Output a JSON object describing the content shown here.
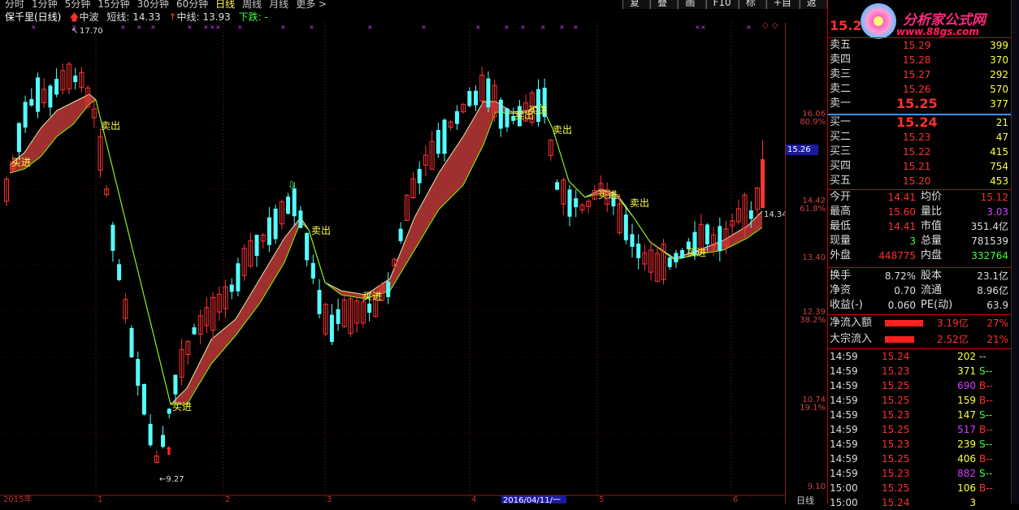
{
  "topbar": {
    "periods": [
      "分时",
      "1分钟",
      "5分钟",
      "15分钟",
      "30分钟",
      "60分钟",
      "日线",
      "周线",
      "月线",
      "更多 >"
    ],
    "active_period": "日线",
    "buttons": [
      "复权",
      "叠加",
      "画线",
      "F10",
      "标记",
      "+自选",
      "返回"
    ]
  },
  "info": {
    "stock": "保千里(日线)",
    "wave": "中波",
    "short_label": "短线:",
    "short_value": "14.33",
    "mid_label": "中线:",
    "mid_value": "13.93",
    "down_label": "下跌:",
    "down_value": "-"
  },
  "chart": {
    "high_label": "17.70",
    "low_label": "9.27",
    "last_label": "14.34",
    "current_price": "15.26",
    "y_axis": [
      {
        "price": "16.06",
        "pct": "80.9%"
      },
      {
        "price": "14.42",
        "pct": "61.8%"
      },
      {
        "price": "13.40",
        "pct": ""
      },
      {
        "price": "12.39",
        "pct": "38.2%"
      },
      {
        "price": "10.74",
        "pct": "19.1%"
      },
      {
        "price": "9.10",
        "pct": ""
      }
    ],
    "x_labels": [
      "2015年",
      "1",
      "2",
      "3",
      "4",
      "5",
      "6"
    ],
    "selected_date": "2016/04/11/一",
    "bottom_axis_label": "日线",
    "signals": [
      {
        "text": "买进"
      },
      {
        "text": "卖出"
      },
      {
        "text": "买进"
      },
      {
        "text": "卖出"
      },
      {
        "text": "买进"
      },
      {
        "text": "卖出"
      },
      {
        "text": "买进"
      },
      {
        "text": "卖出"
      },
      {
        "text": "买进"
      },
      {
        "text": "卖出"
      },
      {
        "text": "买进"
      }
    ],
    "colors": {
      "up": "#ff3333",
      "down": "#54ffff",
      "band": "#a03030",
      "signal_text": "#ffff40",
      "line": "#80ff00"
    }
  },
  "panel": {
    "price": "15.2",
    "logo_text": "分析家公式网",
    "logo_url": "www.88gs.com",
    "asks": [
      {
        "label": "卖五",
        "price": "15.29",
        "vol": "399"
      },
      {
        "label": "卖四",
        "price": "15.28",
        "vol": "370"
      },
      {
        "label": "卖三",
        "price": "15.27",
        "vol": "292"
      },
      {
        "label": "卖二",
        "price": "15.26",
        "vol": "570"
      },
      {
        "label": "卖一",
        "price": "15.25",
        "vol": "377"
      }
    ],
    "bids": [
      {
        "label": "买一",
        "price": "15.24",
        "vol": "21"
      },
      {
        "label": "买二",
        "price": "15.23",
        "vol": "47"
      },
      {
        "label": "买三",
        "price": "15.22",
        "vol": "415"
      },
      {
        "label": "买四",
        "price": "15.21",
        "vol": "754"
      },
      {
        "label": "买五",
        "price": "15.20",
        "vol": "453"
      }
    ],
    "stats": [
      {
        "l1": "今开",
        "v1": "14.41",
        "l2": "均价",
        "v2": "15.12"
      },
      {
        "l1": "最高",
        "v1": "15.60",
        "l2": "量比",
        "v2": "3.03"
      },
      {
        "l1": "最低",
        "v1": "14.41",
        "l2": "市值",
        "v2": "351.4亿"
      },
      {
        "l1": "现量",
        "v1": "3",
        "l2": "总量",
        "v2": "781539"
      },
      {
        "l1": "外盘",
        "v1": "448775",
        "l2": "内盘",
        "v2": "332764"
      }
    ],
    "stats2": [
      {
        "l1": "换手",
        "v1": "8.72%",
        "l2": "股本",
        "v2": "23.1亿"
      },
      {
        "l1": "净资",
        "v1": "0.70",
        "l2": "流通",
        "v2": "8.96亿"
      },
      {
        "l1": "收益(-)",
        "v1": "0.060",
        "l2": "PE(动)",
        "v2": "63.9"
      }
    ],
    "flows": [
      {
        "label": "净流入额",
        "value": "3.19亿",
        "pct": "27%",
        "fill": 0.9
      },
      {
        "label": "大宗流入",
        "value": "2.52亿",
        "pct": "21%",
        "fill": 0.7
      }
    ],
    "ticks": [
      {
        "time": "14:59",
        "price": "15.24",
        "vol": "202",
        "side": "--"
      },
      {
        "time": "14:59",
        "price": "15.23",
        "vol": "371",
        "side": "S--"
      },
      {
        "time": "14:59",
        "price": "15.25",
        "vol": "690",
        "side": "B--"
      },
      {
        "time": "14:59",
        "price": "15.25",
        "vol": "159",
        "side": "B--"
      },
      {
        "time": "14:59",
        "price": "15.23",
        "vol": "147",
        "side": "S--"
      },
      {
        "time": "14:59",
        "price": "15.25",
        "vol": "517",
        "side": "B--"
      },
      {
        "time": "14:59",
        "price": "15.23",
        "vol": "239",
        "side": "S--"
      },
      {
        "time": "14:59",
        "price": "15.25",
        "vol": "406",
        "side": "B--"
      },
      {
        "time": "14:59",
        "price": "15.23",
        "vol": "882",
        "side": "S--"
      },
      {
        "time": "15:00",
        "price": "15.25",
        "vol": "106",
        "side": "B--"
      },
      {
        "time": "15:00",
        "price": "15.24",
        "vol": "3",
        "side": ""
      }
    ]
  }
}
